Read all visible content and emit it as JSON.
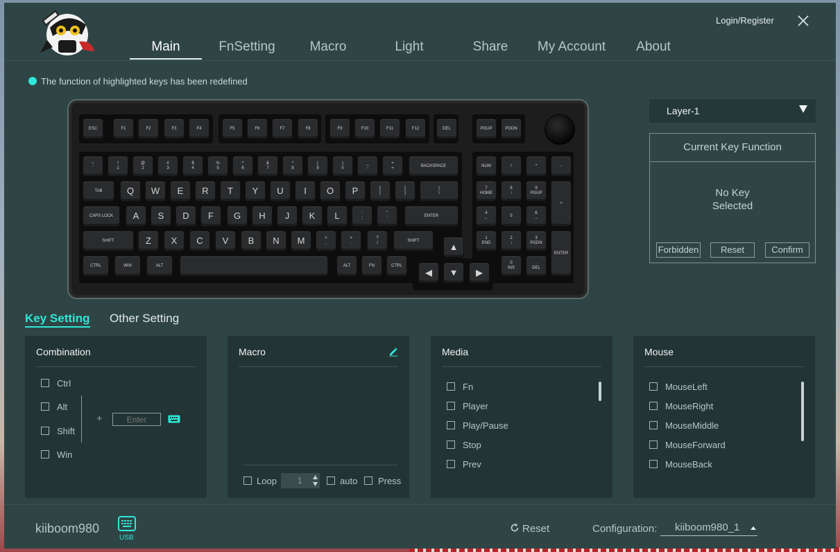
{
  "header": {
    "tabs": [
      "Main",
      "FnSetting",
      "Macro",
      "Light",
      "Share",
      "My Account",
      "About"
    ],
    "active_tab": "Main",
    "login": "Login/Register"
  },
  "notice": "The function of highlighted keys has been redefined",
  "keyboard": {
    "esc": "ESC",
    "f1": "F1",
    "f2": "F2",
    "f3": "F3",
    "f4": "F4",
    "f5": "F5",
    "f6": "F6",
    "f7": "F7",
    "f8": "F8",
    "f9": "F9",
    "f10": "F10",
    "f11": "F11",
    "f12": "F12",
    "del": "DEL",
    "pgup": "PGUP",
    "pgdn": "PGDN",
    "grave": "~\n`",
    "k1": "!\n1",
    "k2": "@\n2",
    "k3": "#\n3",
    "k4": "$\n4",
    "k5": "%\n5",
    "k6": "^\n6",
    "k7": "&\n7",
    "k8": "*\n8",
    "k9": "(\n9",
    "k0": ")\n0",
    "minus": "_\n-",
    "equal": "+\n=",
    "backspace": "BACKSPACE",
    "tab": "TAB",
    "q": "Q",
    "w": "W",
    "e": "E",
    "r": "R",
    "t": "T",
    "y": "Y",
    "u": "U",
    "i": "I",
    "o": "O",
    "p": "P",
    "lbracket": "{\n[",
    "rbracket": "}\n]",
    "backslash": "|\n\\",
    "caps": "CAPS LOCK",
    "a": "A",
    "s": "S",
    "d": "D",
    "f": "F",
    "g": "G",
    "h": "H",
    "j": "J",
    "k": "K",
    "l": "L",
    "semicolon": ":\n;",
    "quote": "\"\n'",
    "enter": "ENTER",
    "lshift": "SHIFT",
    "z": "Z",
    "x": "X",
    "c": "C",
    "v": "V",
    "b": "B",
    "n": "N",
    "m": "M",
    "comma": "<\n,",
    "period": ">\n.",
    "slash": "?\n/",
    "rshift": "SHIFT",
    "lctrl": "CTRL",
    "win": "WIN",
    "lalt": "ALT",
    "space": "",
    "ralt": "ALT",
    "fn": "FN",
    "rctrl": "CTRL",
    "up": "▲",
    "left": "◀",
    "down": "▼",
    "right": "▶",
    "num": "NUM",
    "np_slash": "/",
    "np_star": "*",
    "np_minus": "-",
    "np_plus": "+",
    "np7": "7\nHOME",
    "np8": "8\n↑",
    "np9": "9\nPGUP",
    "np4": "4\n←",
    "np5": "5",
    "np6": "6\n→",
    "np1": "1\nEND",
    "np2": "2\n↓",
    "np3": "3\nPGDN",
    "np0": "0\nINS",
    "np_dot": ".\nDEL",
    "np_enter": "ENTER"
  },
  "layer": {
    "selected": "Layer-1"
  },
  "current_key": {
    "title": "Current Key Function",
    "message_line1": "No Key",
    "message_line2": "Selected",
    "forbidden": "Forbidden",
    "reset": "Reset",
    "confirm": "Confirm"
  },
  "sub_tabs": {
    "key_setting": "Key Setting",
    "other_setting": "Other Setting"
  },
  "combination": {
    "title": "Combination",
    "mods": [
      "Ctrl",
      "Alt",
      "Shift",
      "Win"
    ],
    "plus": "+",
    "placeholder": "Enter"
  },
  "macro": {
    "title": "Macro",
    "loop": "Loop",
    "loop_value": "1",
    "auto": "auto",
    "press": "Press"
  },
  "media": {
    "title": "Media",
    "items": [
      "Fn",
      "Player",
      "Play/Pause",
      "Stop",
      "Prev"
    ]
  },
  "mouse": {
    "title": "Mouse",
    "items": [
      "MouseLeft",
      "MouseRight",
      "MouseMiddle",
      "MouseForward",
      "MouseBack"
    ]
  },
  "footer": {
    "device": "kiiboom980",
    "usb": "USB",
    "reset": "Reset",
    "config_label": "Configuration:",
    "config_value": "kiiboom980_1"
  },
  "colors": {
    "accent": "#2ee8d8",
    "panel": "#233434",
    "app_bg": "#2f4545"
  }
}
